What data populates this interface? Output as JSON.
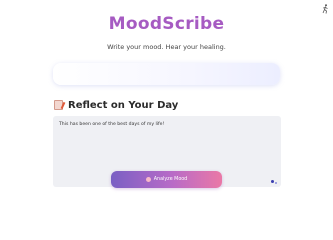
{
  "app": {
    "title": "MoodScribe",
    "tagline": "Write your mood. Hear your healing."
  },
  "corner": {
    "icon": "running-figure-icon"
  },
  "section": {
    "heading": "Reflect on Your Day",
    "icon": "memo-icon"
  },
  "entry": {
    "value": "This has been one of the best days of my life!"
  },
  "actions": {
    "analyze_label": "Analyze Mood",
    "analyze_icon": "brain-icon"
  },
  "colors": {
    "title": "#a65bc2",
    "button_start": "#7a5fc4",
    "button_end": "#ea78a6",
    "textarea_bg": "#eff0f4"
  }
}
